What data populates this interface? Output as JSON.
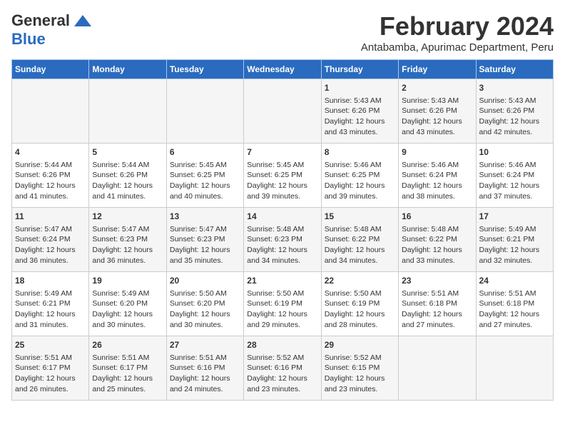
{
  "header": {
    "logo_general": "General",
    "logo_blue": "Blue",
    "title": "February 2024",
    "location": "Antabamba, Apurimac Department, Peru"
  },
  "days_of_week": [
    "Sunday",
    "Monday",
    "Tuesday",
    "Wednesday",
    "Thursday",
    "Friday",
    "Saturday"
  ],
  "weeks": [
    [
      {
        "day": "",
        "content": ""
      },
      {
        "day": "",
        "content": ""
      },
      {
        "day": "",
        "content": ""
      },
      {
        "day": "",
        "content": ""
      },
      {
        "day": "1",
        "content": "Sunrise: 5:43 AM\nSunset: 6:26 PM\nDaylight: 12 hours\nand 43 minutes."
      },
      {
        "day": "2",
        "content": "Sunrise: 5:43 AM\nSunset: 6:26 PM\nDaylight: 12 hours\nand 43 minutes."
      },
      {
        "day": "3",
        "content": "Sunrise: 5:43 AM\nSunset: 6:26 PM\nDaylight: 12 hours\nand 42 minutes."
      }
    ],
    [
      {
        "day": "4",
        "content": "Sunrise: 5:44 AM\nSunset: 6:26 PM\nDaylight: 12 hours\nand 41 minutes."
      },
      {
        "day": "5",
        "content": "Sunrise: 5:44 AM\nSunset: 6:26 PM\nDaylight: 12 hours\nand 41 minutes."
      },
      {
        "day": "6",
        "content": "Sunrise: 5:45 AM\nSunset: 6:25 PM\nDaylight: 12 hours\nand 40 minutes."
      },
      {
        "day": "7",
        "content": "Sunrise: 5:45 AM\nSunset: 6:25 PM\nDaylight: 12 hours\nand 39 minutes."
      },
      {
        "day": "8",
        "content": "Sunrise: 5:46 AM\nSunset: 6:25 PM\nDaylight: 12 hours\nand 39 minutes."
      },
      {
        "day": "9",
        "content": "Sunrise: 5:46 AM\nSunset: 6:24 PM\nDaylight: 12 hours\nand 38 minutes."
      },
      {
        "day": "10",
        "content": "Sunrise: 5:46 AM\nSunset: 6:24 PM\nDaylight: 12 hours\nand 37 minutes."
      }
    ],
    [
      {
        "day": "11",
        "content": "Sunrise: 5:47 AM\nSunset: 6:24 PM\nDaylight: 12 hours\nand 36 minutes."
      },
      {
        "day": "12",
        "content": "Sunrise: 5:47 AM\nSunset: 6:23 PM\nDaylight: 12 hours\nand 36 minutes."
      },
      {
        "day": "13",
        "content": "Sunrise: 5:47 AM\nSunset: 6:23 PM\nDaylight: 12 hours\nand 35 minutes."
      },
      {
        "day": "14",
        "content": "Sunrise: 5:48 AM\nSunset: 6:23 PM\nDaylight: 12 hours\nand 34 minutes."
      },
      {
        "day": "15",
        "content": "Sunrise: 5:48 AM\nSunset: 6:22 PM\nDaylight: 12 hours\nand 34 minutes."
      },
      {
        "day": "16",
        "content": "Sunrise: 5:48 AM\nSunset: 6:22 PM\nDaylight: 12 hours\nand 33 minutes."
      },
      {
        "day": "17",
        "content": "Sunrise: 5:49 AM\nSunset: 6:21 PM\nDaylight: 12 hours\nand 32 minutes."
      }
    ],
    [
      {
        "day": "18",
        "content": "Sunrise: 5:49 AM\nSunset: 6:21 PM\nDaylight: 12 hours\nand 31 minutes."
      },
      {
        "day": "19",
        "content": "Sunrise: 5:49 AM\nSunset: 6:20 PM\nDaylight: 12 hours\nand 30 minutes."
      },
      {
        "day": "20",
        "content": "Sunrise: 5:50 AM\nSunset: 6:20 PM\nDaylight: 12 hours\nand 30 minutes."
      },
      {
        "day": "21",
        "content": "Sunrise: 5:50 AM\nSunset: 6:19 PM\nDaylight: 12 hours\nand 29 minutes."
      },
      {
        "day": "22",
        "content": "Sunrise: 5:50 AM\nSunset: 6:19 PM\nDaylight: 12 hours\nand 28 minutes."
      },
      {
        "day": "23",
        "content": "Sunrise: 5:51 AM\nSunset: 6:18 PM\nDaylight: 12 hours\nand 27 minutes."
      },
      {
        "day": "24",
        "content": "Sunrise: 5:51 AM\nSunset: 6:18 PM\nDaylight: 12 hours\nand 27 minutes."
      }
    ],
    [
      {
        "day": "25",
        "content": "Sunrise: 5:51 AM\nSunset: 6:17 PM\nDaylight: 12 hours\nand 26 minutes."
      },
      {
        "day": "26",
        "content": "Sunrise: 5:51 AM\nSunset: 6:17 PM\nDaylight: 12 hours\nand 25 minutes."
      },
      {
        "day": "27",
        "content": "Sunrise: 5:51 AM\nSunset: 6:16 PM\nDaylight: 12 hours\nand 24 minutes."
      },
      {
        "day": "28",
        "content": "Sunrise: 5:52 AM\nSunset: 6:16 PM\nDaylight: 12 hours\nand 23 minutes."
      },
      {
        "day": "29",
        "content": "Sunrise: 5:52 AM\nSunset: 6:15 PM\nDaylight: 12 hours\nand 23 minutes."
      },
      {
        "day": "",
        "content": ""
      },
      {
        "day": "",
        "content": ""
      }
    ]
  ]
}
